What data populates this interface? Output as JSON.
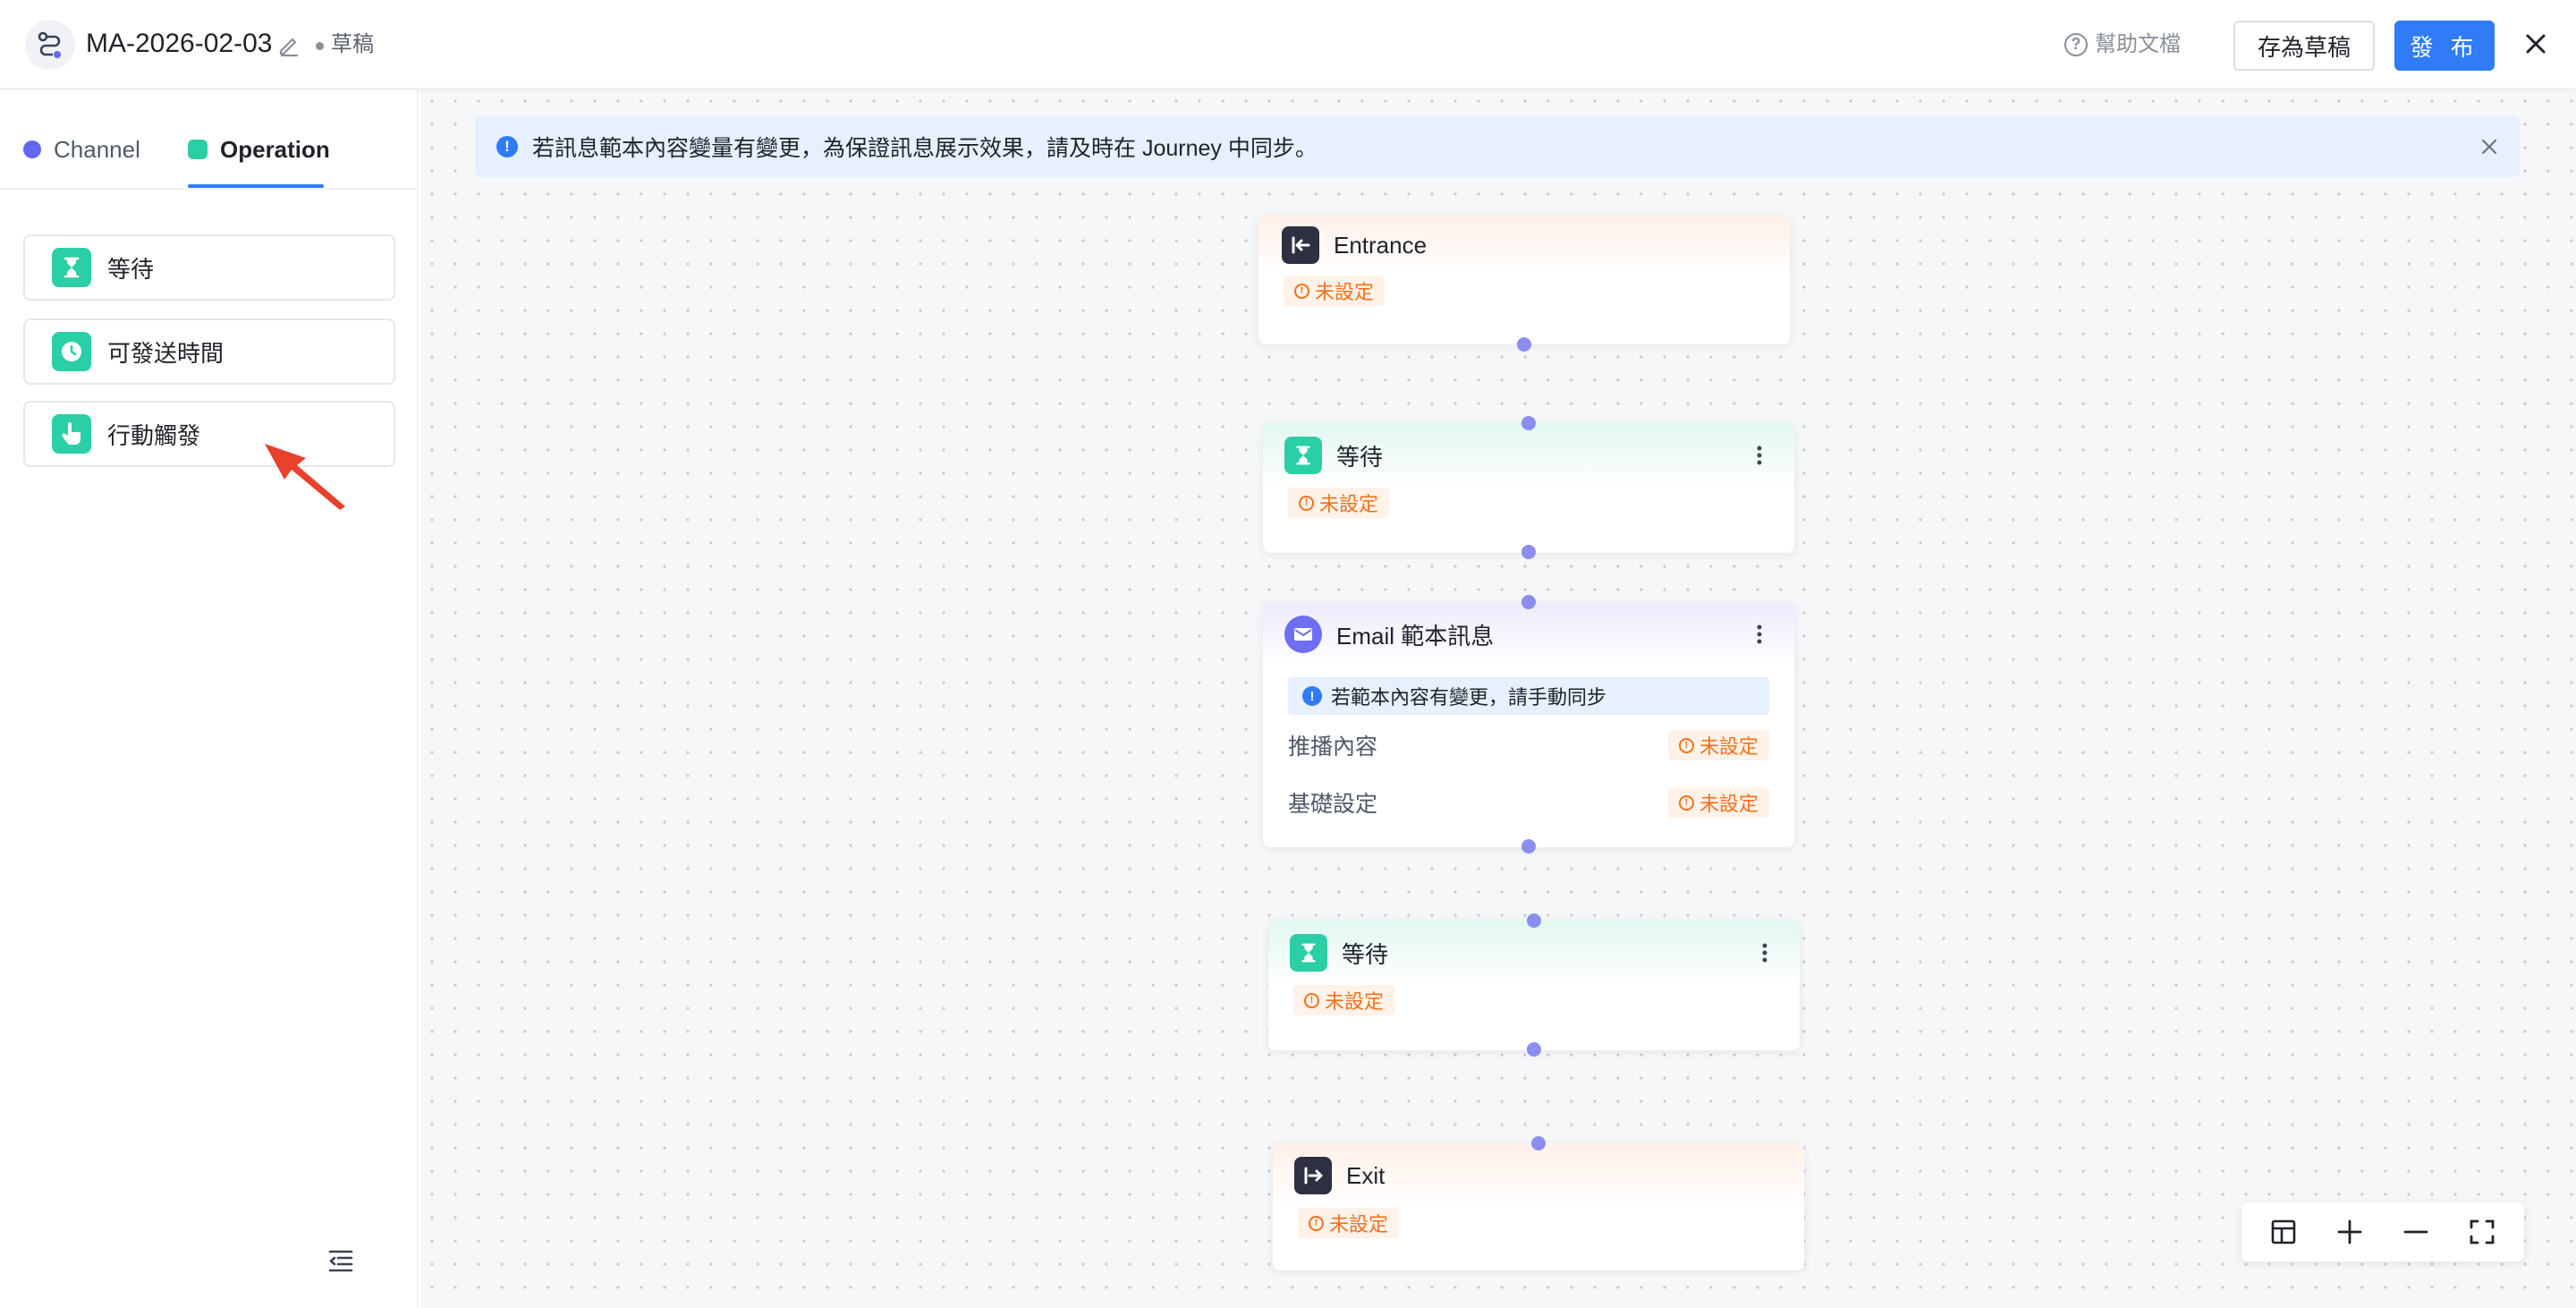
{
  "header": {
    "title": "MA-2026-02-03",
    "status": "草稿",
    "help": "幫助文檔",
    "save_draft": "存為草稿",
    "publish": "發 布"
  },
  "sidebar": {
    "tabs": [
      {
        "label": "Channel",
        "color": "#6366f1"
      },
      {
        "label": "Operation",
        "color": "#2bcfa5",
        "active": true
      }
    ],
    "operations": [
      {
        "label": "等待",
        "icon": "hourglass-icon"
      },
      {
        "label": "可發送時間",
        "icon": "clock-icon"
      },
      {
        "label": "行動觸發",
        "icon": "hand-pointer-icon"
      }
    ]
  },
  "notice": {
    "text": "若訊息範本內容變量有變更，為保證訊息展示效果，請及時在 Journey 中同步。"
  },
  "nodes": {
    "entrance": {
      "title": "Entrance",
      "status": "未設定"
    },
    "wait1": {
      "title": "等待",
      "status": "未設定"
    },
    "email": {
      "title": "Email 範本訊息",
      "note": "若範本內容有變更，請手動同步",
      "rows": [
        {
          "label": "推播內容",
          "status": "未設定"
        },
        {
          "label": "基礎設定",
          "status": "未設定"
        }
      ]
    },
    "wait2": {
      "title": "等待",
      "status": "未設定"
    },
    "exit": {
      "title": "Exit",
      "status": "未設定"
    }
  },
  "colors": {
    "primary": "#2f7cf6",
    "operation_green": "#2bcfa5",
    "warning_orange": "#f5711c",
    "port_purple": "#8c8df0"
  }
}
